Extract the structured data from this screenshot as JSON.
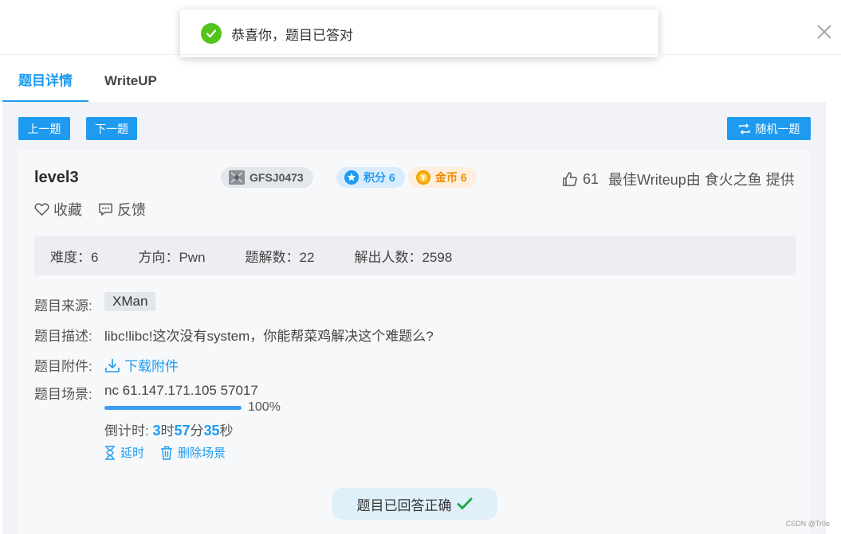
{
  "toast": {
    "message": "恭喜你，题目已答对"
  },
  "tabs": [
    {
      "label": "题目详情",
      "active": true
    },
    {
      "label": "WriteUP",
      "active": false
    }
  ],
  "nav": {
    "prev_label": "上一题",
    "next_label": "下一题",
    "random_label": "随机一题"
  },
  "challenge": {
    "title": "level3",
    "author": "GFSJ0473",
    "score_label": "积分 6",
    "coin_label": "金币 6",
    "likes": "61",
    "best_writeup": "最佳Writeup由 食火之鱼 提供",
    "favorite_label": "收藏",
    "feedback_label": "反馈"
  },
  "stats": {
    "difficulty": "难度：6",
    "direction": "方向：Pwn",
    "solve_count": "题解数：22",
    "solvers": "解出人数：2598"
  },
  "details": {
    "source_label": "题目来源:",
    "source_value": "XMan",
    "desc_label": "题目描述:",
    "desc_value": "libc!libc!这次没有system，你能帮菜鸡解决这个难题么?",
    "attach_label": "题目附件:",
    "attach_value": "下载附件",
    "scene_label": "题目场景:",
    "scene_address": "nc 61.147.171.105 57017",
    "progress": 100,
    "progress_text": "100%",
    "countdown_prefix": "倒计时: ",
    "hours": "3",
    "hour_unit": "时",
    "minutes": "57",
    "minute_unit": "分",
    "seconds": "35",
    "second_unit": "秒",
    "extend_label": "延时",
    "delete_label": "删除场景"
  },
  "answered_label": "题目已回答正确",
  "watermark": "CSDN @Tr0e",
  "colors": {
    "accent": "#1e9bf0",
    "success": "#52c41a",
    "coin": "#f08a00"
  }
}
